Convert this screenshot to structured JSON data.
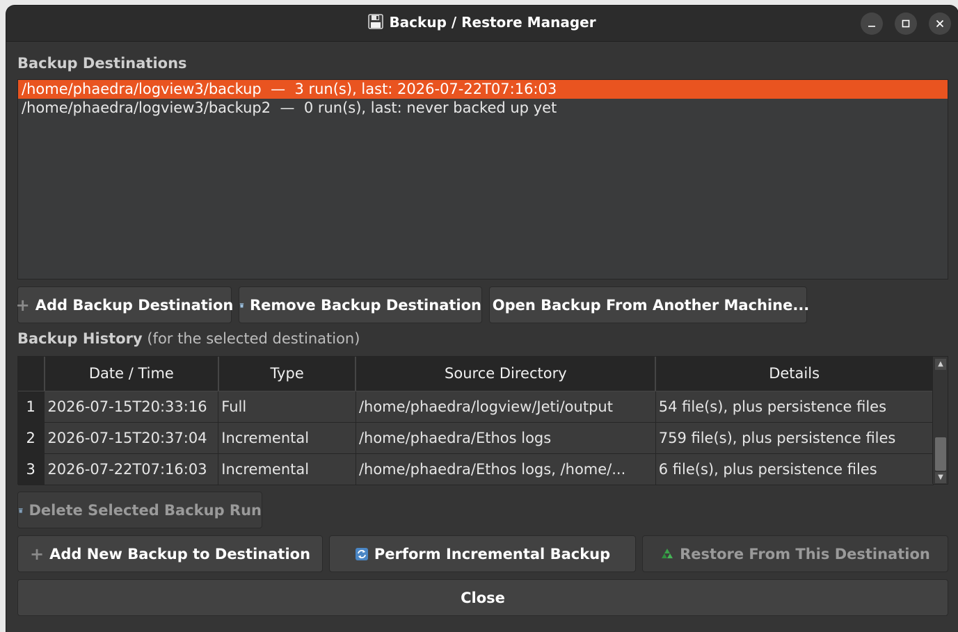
{
  "window": {
    "title": "Backup / Restore Manager",
    "title_icon": "floppy-disk-icon",
    "controls": [
      "minimize",
      "maximize",
      "close"
    ]
  },
  "destinations": {
    "label": "Backup Destinations",
    "items": [
      {
        "path": "/home/phaedra/logview3/backup",
        "summary": "3 run(s), last: 2026-07-22T07:16:03",
        "selected": true
      },
      {
        "path": "/home/phaedra/logview3/backup2",
        "summary": "0 run(s), last: never backed up yet",
        "selected": false
      }
    ],
    "separator": "—"
  },
  "dest_buttons": {
    "add": "Add Backup Destination",
    "remove": "Remove Backup Destination",
    "open": "Open Backup From Another Machine..."
  },
  "history": {
    "label_bold": "Backup History",
    "label_rest": "(for the selected destination)",
    "columns": [
      "Date / Time",
      "Type",
      "Source Directory",
      "Details"
    ],
    "rows": [
      {
        "num": "1",
        "datetime": "2026-07-15T20:33:16",
        "type": "Full",
        "source": "/home/phaedra/logview/Jeti/output",
        "details": "54 file(s), plus persistence files"
      },
      {
        "num": "2",
        "datetime": "2026-07-15T20:37:04",
        "type": "Incremental",
        "source": "/home/phaedra/Ethos logs",
        "details": "759 file(s), plus persistence files"
      },
      {
        "num": "3",
        "datetime": "2026-07-22T07:16:03",
        "type": "Incremental",
        "source": "/home/phaedra/Ethos logs, /home/...",
        "details": "6 file(s), plus persistence files"
      }
    ]
  },
  "run_buttons": {
    "delete": "Delete Selected Backup Run",
    "add_new": "Add New Backup to Destination",
    "incremental": "Perform Incremental Backup",
    "restore": "Restore From This Destination",
    "close": "Close"
  },
  "colors": {
    "accent": "#e95420",
    "window_bg": "#353535",
    "titlebar_bg": "#2c2c2c"
  }
}
